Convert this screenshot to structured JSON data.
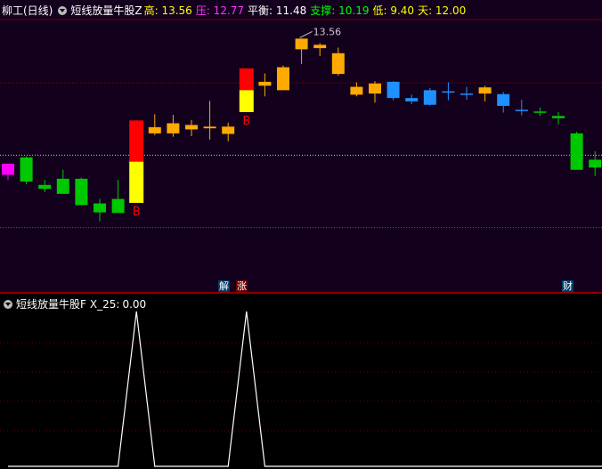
{
  "main_header": {
    "stock_name": "柳工(日线)",
    "indicator_name": "短线放量牛股Z",
    "items": [
      {
        "label": "高:",
        "value": "13.56",
        "color": "#ffff00"
      },
      {
        "label": "压:",
        "value": "12.77",
        "color": "#ff33ff"
      },
      {
        "label": "平衡:",
        "value": "11.48",
        "color": "#ffffff"
      },
      {
        "label": "支撑:",
        "value": "10.19",
        "color": "#00ff00"
      },
      {
        "label": "低:",
        "value": "9.40",
        "color": "#ffff00"
      },
      {
        "label": "天:",
        "value": "12.00",
        "color": "#ffff00"
      }
    ]
  },
  "sub_header": {
    "indicator_name": "短线放量牛股F",
    "label": "X_25:",
    "value": "0.00"
  },
  "signals": {
    "jie": "解",
    "zhang": "涨",
    "cai": "财"
  },
  "colors": {
    "up_gold": "#ffaa00",
    "down_green": "#00c800",
    "blue": "#1e90ff",
    "magenta": "#ff00ff",
    "red": "#ff0000",
    "yellow": "#ffff00",
    "pressure_line": "#a00000",
    "support_line": "#00a000",
    "balance_line": "#c8c8c8"
  },
  "chart_data": [
    {
      "type": "candlestick",
      "title": "短线放量牛股Z",
      "ylim": [
        9.2,
        13.9
      ],
      "reference_lines": [
        {
          "name": "压",
          "value": 12.77
        },
        {
          "name": "平衡",
          "value": 11.48
        },
        {
          "name": "支撑",
          "value": 10.19
        }
      ],
      "peak_annotation": {
        "text": "13.56",
        "value": 13.56
      },
      "buy_marker_text": "B",
      "candles": [
        {
          "open": 11.13,
          "high": 11.33,
          "low": 11.04,
          "close": 11.33,
          "color": "magenta"
        },
        {
          "open": 11.44,
          "high": 11.46,
          "low": 10.96,
          "close": 11.01,
          "color": "green"
        },
        {
          "open": 10.95,
          "high": 11.04,
          "low": 10.82,
          "close": 10.88,
          "color": "green"
        },
        {
          "open": 11.06,
          "high": 11.22,
          "low": 10.82,
          "close": 10.79,
          "color": "green"
        },
        {
          "open": 11.06,
          "high": 11.08,
          "low": 10.61,
          "close": 10.59,
          "color": "green"
        },
        {
          "open": 10.62,
          "high": 10.7,
          "low": 10.3,
          "close": 10.46,
          "color": "green"
        },
        {
          "open": 10.7,
          "high": 11.04,
          "low": 10.49,
          "close": 10.45,
          "color": "green"
        },
        {
          "open": 10.7,
          "high": 12.1,
          "low": 10.63,
          "close": 12.1,
          "color": "gold",
          "buy": true,
          "volume_bar": true
        },
        {
          "open": 11.87,
          "high": 12.21,
          "low": 11.84,
          "close": 11.98,
          "color": "gold"
        },
        {
          "open": 11.87,
          "high": 12.2,
          "low": 11.81,
          "close": 12.05,
          "color": "gold"
        },
        {
          "open": 11.94,
          "high": 12.11,
          "low": 11.82,
          "close": 12.02,
          "color": "gold"
        },
        {
          "open": 11.96,
          "high": 12.45,
          "low": 11.76,
          "close": 11.99,
          "color": "gold"
        },
        {
          "open": 11.86,
          "high": 12.06,
          "low": 11.73,
          "close": 11.99,
          "color": "gold"
        },
        {
          "open": 12.25,
          "high": 13.03,
          "low": 12.25,
          "close": 13.03,
          "color": "gold",
          "buy": true,
          "volume_bar": true
        },
        {
          "open": 12.72,
          "high": 12.94,
          "low": 12.53,
          "close": 12.79,
          "color": "gold"
        },
        {
          "open": 12.64,
          "high": 13.08,
          "low": 12.64,
          "close": 13.05,
          "color": "gold"
        },
        {
          "open": 13.37,
          "high": 13.56,
          "low": 13.11,
          "close": 13.56,
          "color": "gold"
        },
        {
          "open": 13.39,
          "high": 13.48,
          "low": 13.25,
          "close": 13.45,
          "color": "gold"
        },
        {
          "open": 12.93,
          "high": 13.4,
          "low": 12.9,
          "close": 13.3,
          "color": "gold"
        },
        {
          "open": 12.56,
          "high": 12.78,
          "low": 12.53,
          "close": 12.7,
          "color": "gold"
        },
        {
          "open": 12.58,
          "high": 12.8,
          "low": 12.42,
          "close": 12.76,
          "color": "gold"
        },
        {
          "open": 12.79,
          "high": 12.8,
          "low": 12.46,
          "close": 12.5,
          "color": "blue"
        },
        {
          "open": 12.5,
          "high": 12.56,
          "low": 12.39,
          "close": 12.44,
          "color": "blue"
        },
        {
          "open": 12.64,
          "high": 12.68,
          "low": 12.37,
          "close": 12.38,
          "color": "blue"
        },
        {
          "open": 12.62,
          "high": 12.78,
          "low": 12.46,
          "close": 12.62,
          "color": "blue"
        },
        {
          "open": 12.58,
          "high": 12.7,
          "low": 12.47,
          "close": 12.58,
          "color": "blue"
        },
        {
          "open": 12.58,
          "high": 12.72,
          "low": 12.44,
          "close": 12.69,
          "color": "gold"
        },
        {
          "open": 12.57,
          "high": 12.61,
          "low": 12.24,
          "close": 12.36,
          "color": "blue"
        },
        {
          "open": 12.29,
          "high": 12.47,
          "low": 12.19,
          "close": 12.29,
          "color": "blue"
        },
        {
          "open": 12.26,
          "high": 12.33,
          "low": 12.18,
          "close": 12.24,
          "color": "green"
        },
        {
          "open": 12.18,
          "high": 12.25,
          "low": 12.03,
          "close": 12.14,
          "color": "green"
        },
        {
          "open": 11.87,
          "high": 11.9,
          "low": 11.24,
          "close": 11.22,
          "color": "green"
        },
        {
          "open": 11.4,
          "high": 11.55,
          "low": 11.11,
          "close": 11.26,
          "color": "green"
        },
        {
          "open": 11.53,
          "high": 11.55,
          "low": 11.43,
          "close": 11.45,
          "color": "green"
        }
      ]
    },
    {
      "type": "line",
      "title": "短线放量牛股F",
      "series": [
        {
          "name": "X_25",
          "values": [
            0,
            0,
            0,
            0,
            0,
            0,
            0,
            1,
            0,
            0,
            0,
            0,
            0,
            1,
            0,
            0,
            0,
            0,
            0,
            0,
            0,
            0,
            0,
            0,
            0,
            0,
            0,
            0,
            0,
            0,
            0,
            0,
            0,
            0
          ]
        }
      ],
      "ylim": [
        0,
        1
      ]
    }
  ]
}
